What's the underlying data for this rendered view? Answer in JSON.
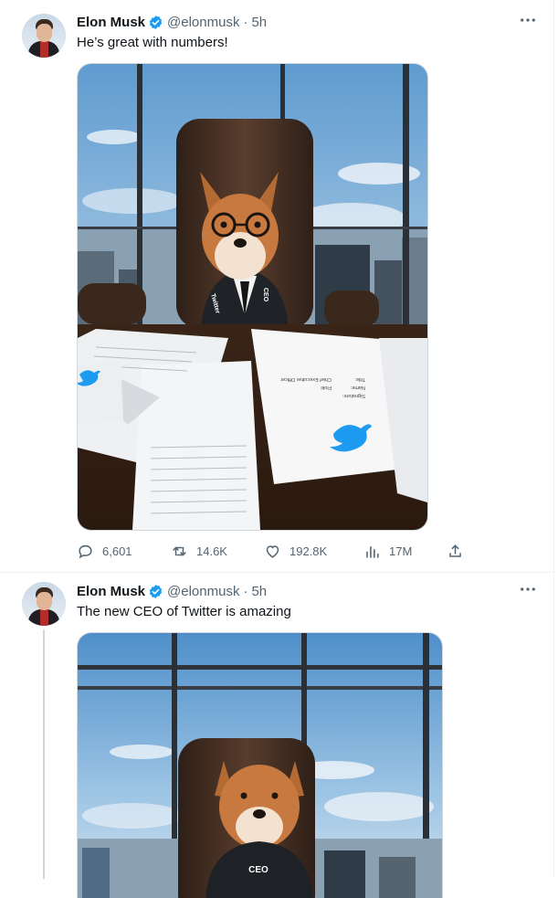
{
  "tweets": [
    {
      "author": {
        "name": "Elon Musk",
        "handle": "@elonmusk"
      },
      "separator": "·",
      "time": "5h",
      "text": "He’s great with numbers!",
      "actions": {
        "replies": "6,601",
        "retweets": "14.6K",
        "likes": "192.8K",
        "views": "17M"
      }
    },
    {
      "author": {
        "name": "Elon Musk",
        "handle": "@elonmusk"
      },
      "separator": "·",
      "time": "5h",
      "text": "The new CEO of Twitter is amazing"
    }
  ],
  "photo_text": {
    "tie_left": "Twitter",
    "tie_right": "CEO",
    "document_lines": [
      "Signature:",
      "Name:",
      "Title:",
      "Floki",
      "Chief Executive Officer"
    ],
    "sweater_label": "CEO"
  },
  "icons": [
    "verified-badge-icon",
    "more-icon",
    "reply-icon",
    "retweet-icon",
    "like-icon",
    "views-icon",
    "share-icon"
  ],
  "colors": {
    "accent": "#1d9bf0",
    "text_primary": "#0f1419",
    "text_secondary": "#536471",
    "border": "#eff3f4"
  }
}
